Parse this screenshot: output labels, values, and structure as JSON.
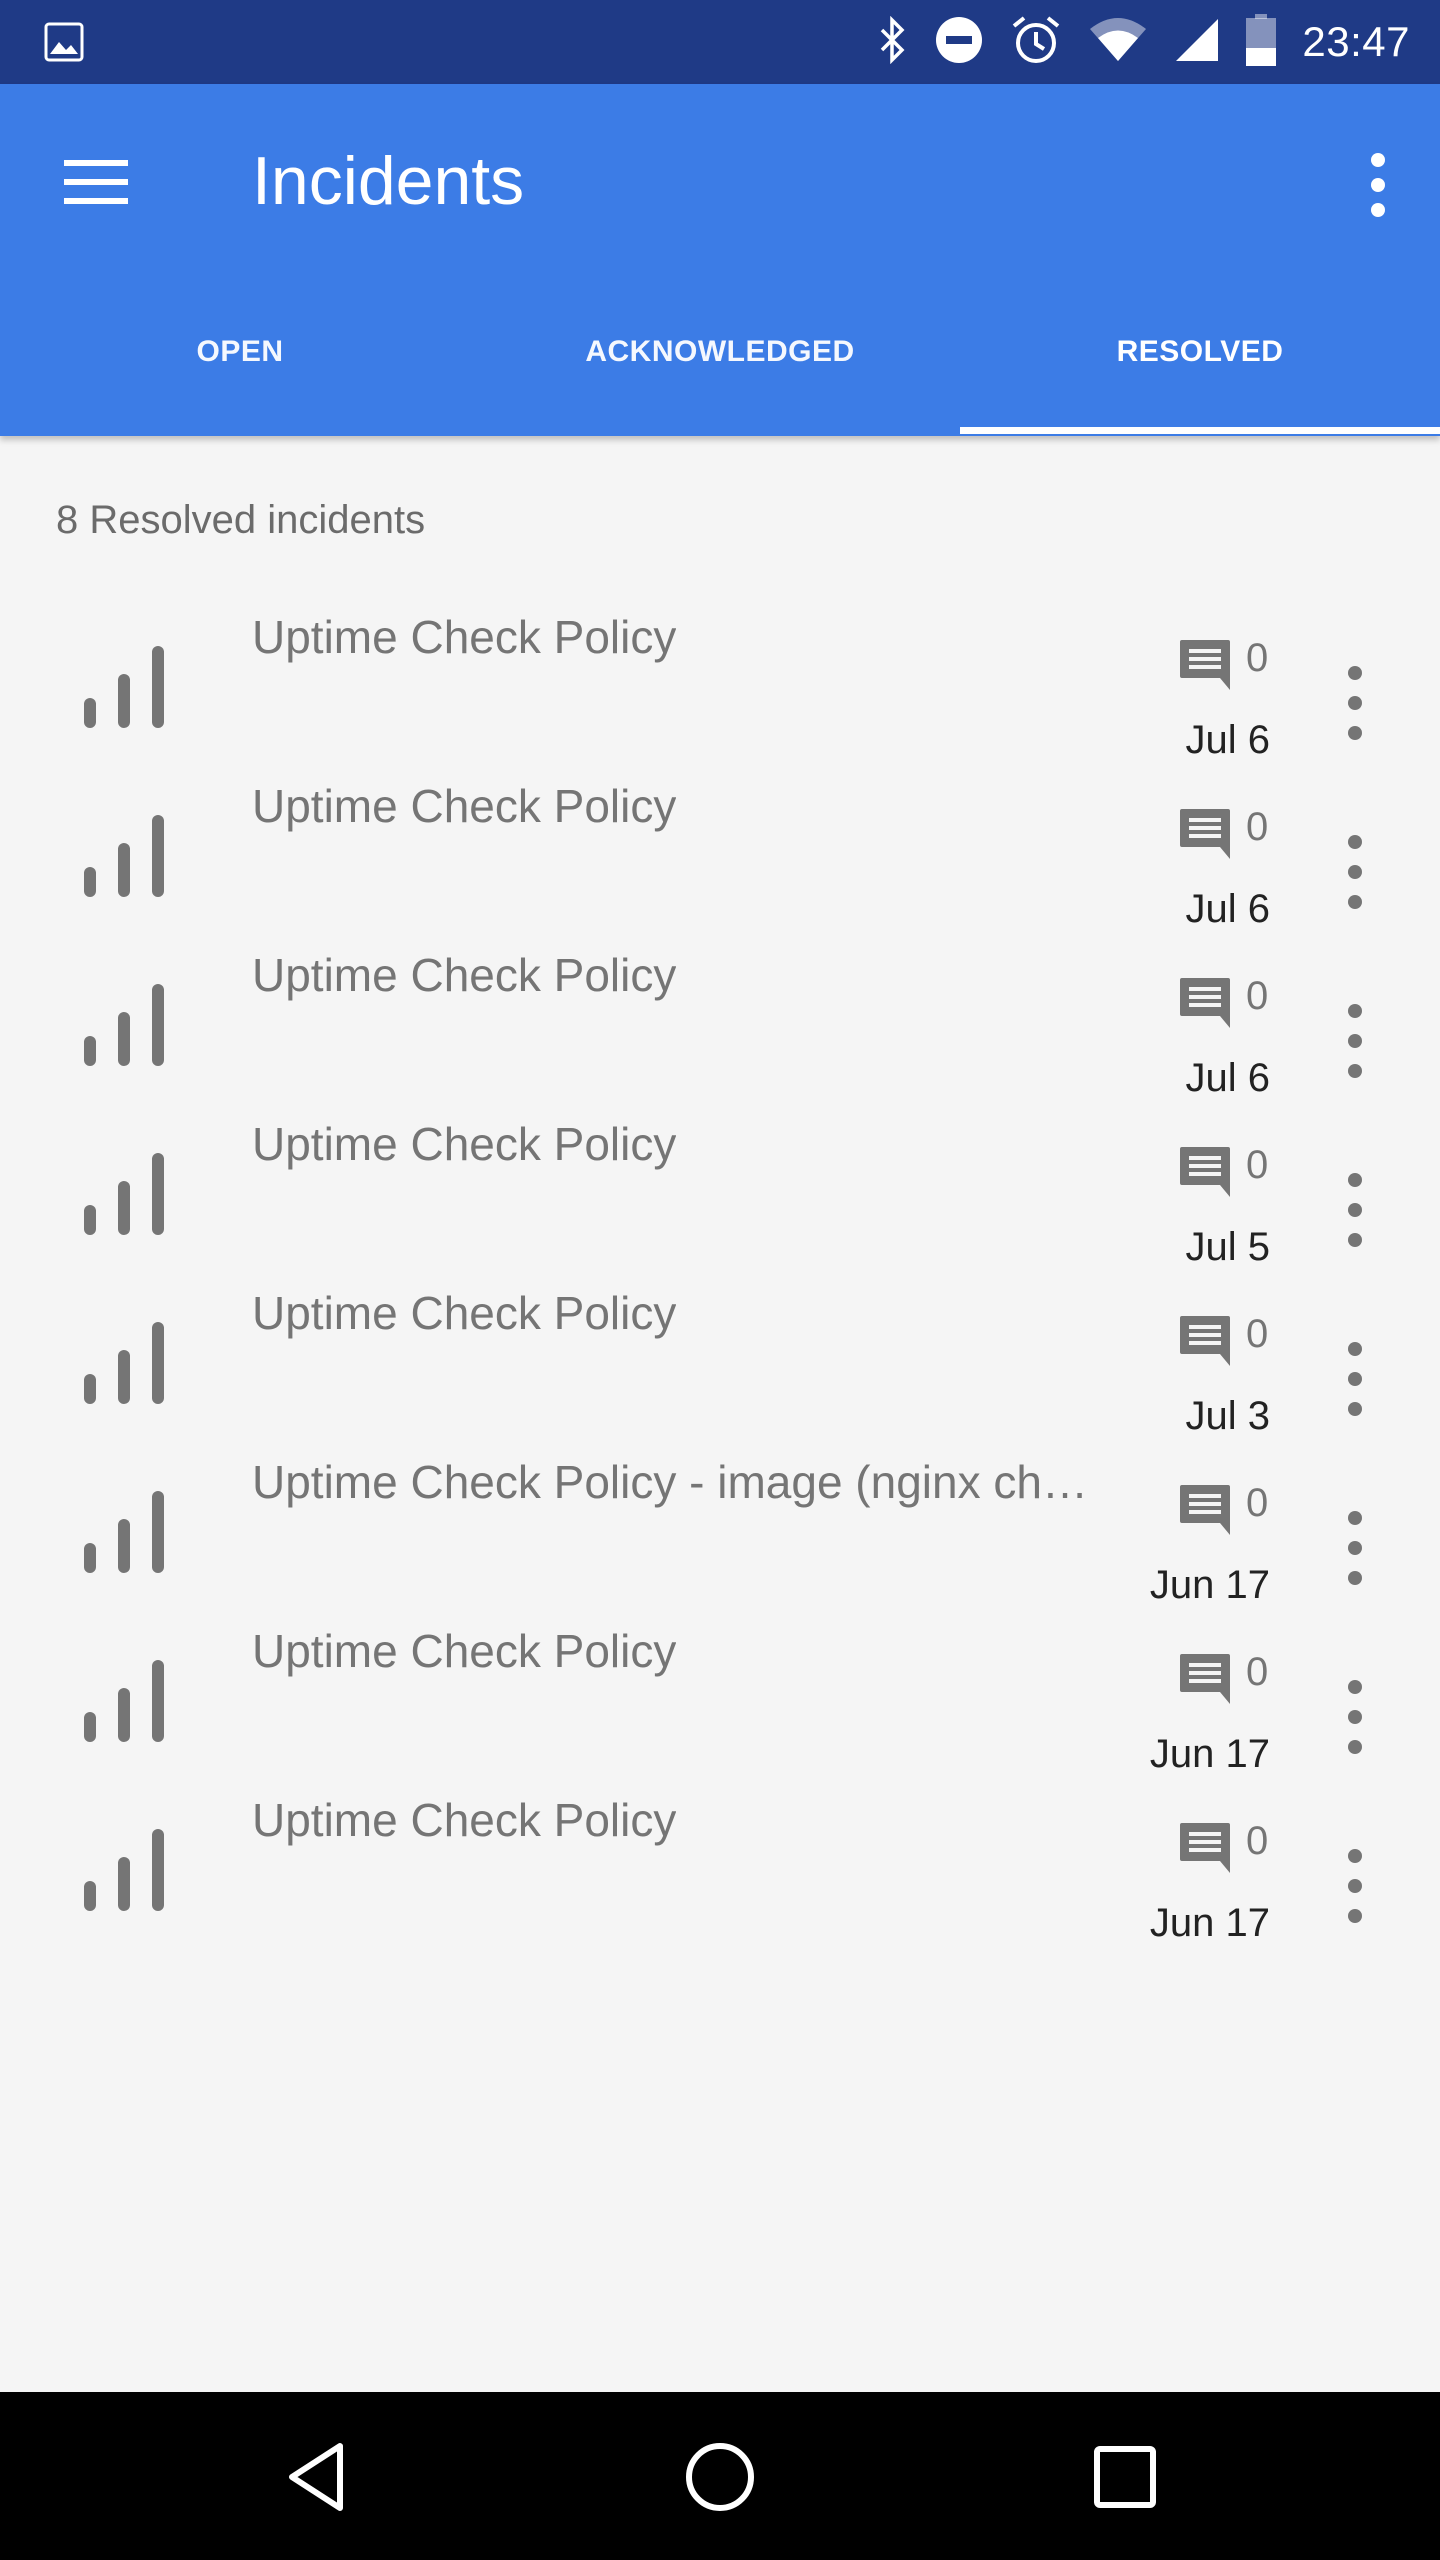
{
  "status_bar": {
    "time": "23:47",
    "icons": [
      "image-icon",
      "bluetooth-icon",
      "do-not-disturb-icon",
      "alarm-icon",
      "wifi-icon",
      "signal-icon",
      "battery-icon"
    ]
  },
  "app_bar": {
    "title": "Incidents",
    "menu_icon": "menu-icon",
    "overflow_icon": "more-vert-icon"
  },
  "tabs": [
    {
      "label": "OPEN",
      "selected": false
    },
    {
      "label": "ACKNOWLEDGED",
      "selected": false
    },
    {
      "label": "RESOLVED",
      "selected": true
    }
  ],
  "summary": "8 Resolved incidents",
  "incidents": [
    {
      "name": "Uptime Check Policy",
      "comments": "0",
      "date": "Jul 6"
    },
    {
      "name": "Uptime Check Policy",
      "comments": "0",
      "date": "Jul 6"
    },
    {
      "name": "Uptime Check Policy",
      "comments": "0",
      "date": "Jul 6"
    },
    {
      "name": "Uptime Check Policy",
      "comments": "0",
      "date": "Jul 5"
    },
    {
      "name": "Uptime Check Policy",
      "comments": "0",
      "date": "Jul 3"
    },
    {
      "name": "Uptime Check Policy - image (nginx ch…",
      "comments": "0",
      "date": "Jun 17"
    },
    {
      "name": "Uptime Check Policy",
      "comments": "0",
      "date": "Jun 17"
    },
    {
      "name": "Uptime Check Policy",
      "comments": "0",
      "date": "Jun 17"
    }
  ],
  "colors": {
    "status_bar": "#1f3a86",
    "app_bar": "#3c7ce6",
    "background": "#f5f5f5",
    "icon_grey": "#757575"
  },
  "nav_bar": {
    "icons": [
      "back-icon",
      "home-icon",
      "recents-icon"
    ]
  }
}
